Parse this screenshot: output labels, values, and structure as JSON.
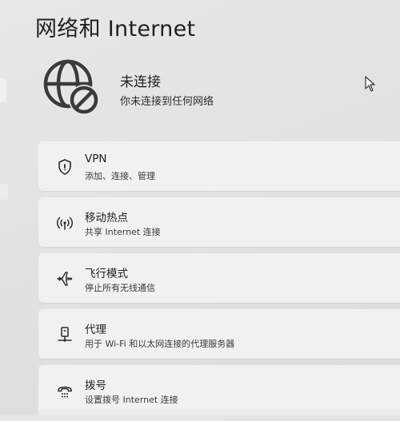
{
  "page": {
    "title": "网络和 Internet"
  },
  "status": {
    "title": "未连接",
    "description": "你未连接到任何网络"
  },
  "items": [
    {
      "label": "VPN",
      "sub": "添加、连接、管理",
      "icon": "shield-icon"
    },
    {
      "label": "移动热点",
      "sub": "共享 Internet 连接",
      "icon": "hotspot-icon"
    },
    {
      "label": "飞行模式",
      "sub": "停止所有无线通信",
      "icon": "airplane-icon"
    },
    {
      "label": "代理",
      "sub": "用于 Wi-Fi 和以太网连接的代理服务器",
      "icon": "proxy-icon"
    },
    {
      "label": "拨号",
      "sub": "设置拨号 Internet 连接",
      "icon": "dialup-icon"
    }
  ],
  "colors": {
    "card": "#f1f1f0",
    "background": "#e3e4e2",
    "text": "#1b1b1b"
  }
}
